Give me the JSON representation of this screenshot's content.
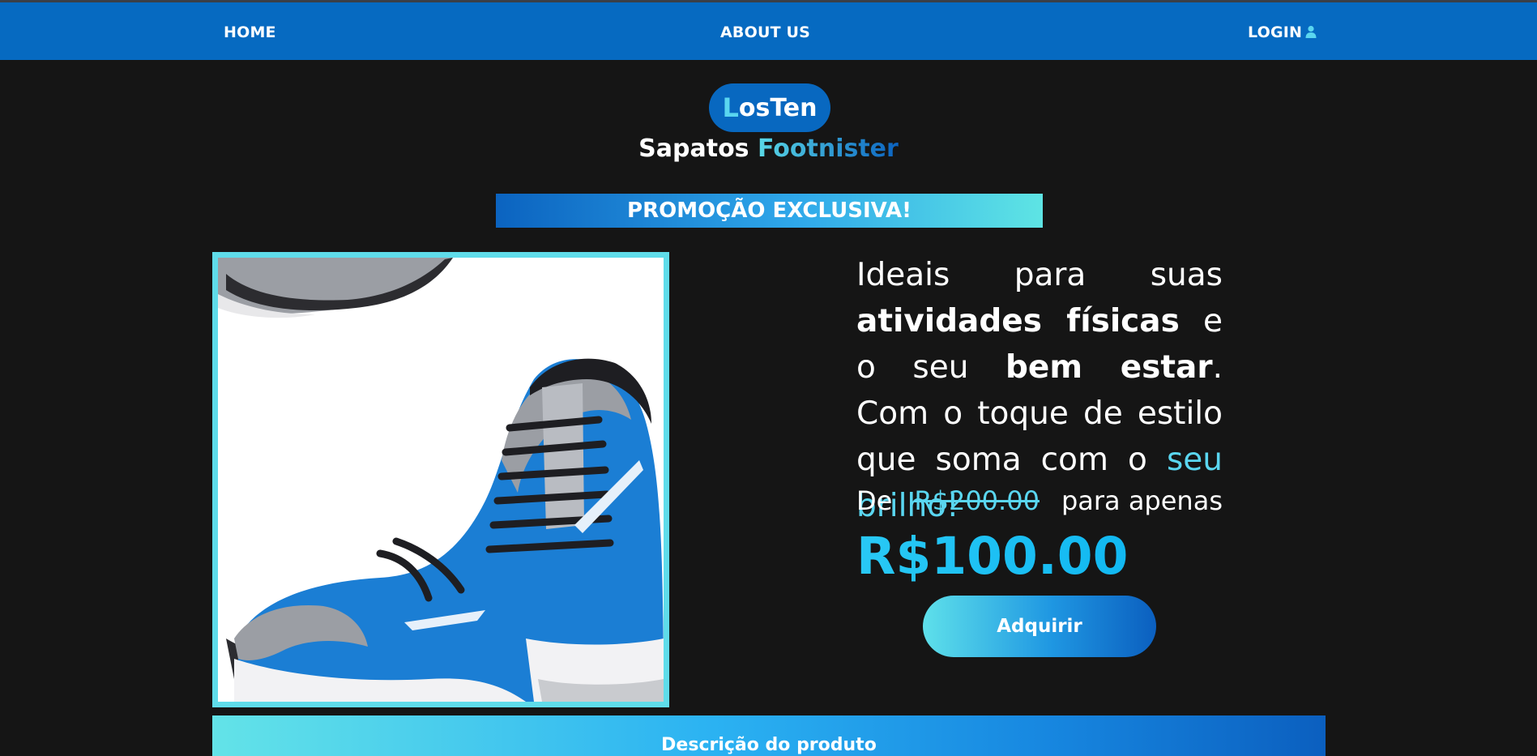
{
  "nav": {
    "home": "HOME",
    "about": "ABOUT US",
    "login": "LOGIN"
  },
  "logo": {
    "first_letter": "L",
    "rest": "osTen"
  },
  "brand": {
    "word1": "Sapatos",
    "word2": "Footnister"
  },
  "promo": {
    "label": "PROMOÇÃO EXCLUSIVA!"
  },
  "product": {
    "image_alt": "blue running sneakers",
    "copy": {
      "p1": "Ideais para suas ",
      "b1": "atividades físicas",
      "p2": " e o seu ",
      "b2": "bem estar",
      "p3": ". Com o toque de estilo que soma com o ",
      "highlight": "seu brilho!"
    },
    "price_prefix": "De",
    "old_price": "R$200.00",
    "price_suffix": "para apenas",
    "new_price": "R$100.00",
    "buy_label": "Adquirir"
  },
  "description": {
    "label": "Descrição do produto"
  },
  "colors": {
    "nav_bg": "#066ac1",
    "page_bg": "#151515",
    "accent_cyan": "#5ad6f0",
    "accent_blue": "#0b63c0"
  },
  "icons": {
    "login": "user-icon"
  }
}
